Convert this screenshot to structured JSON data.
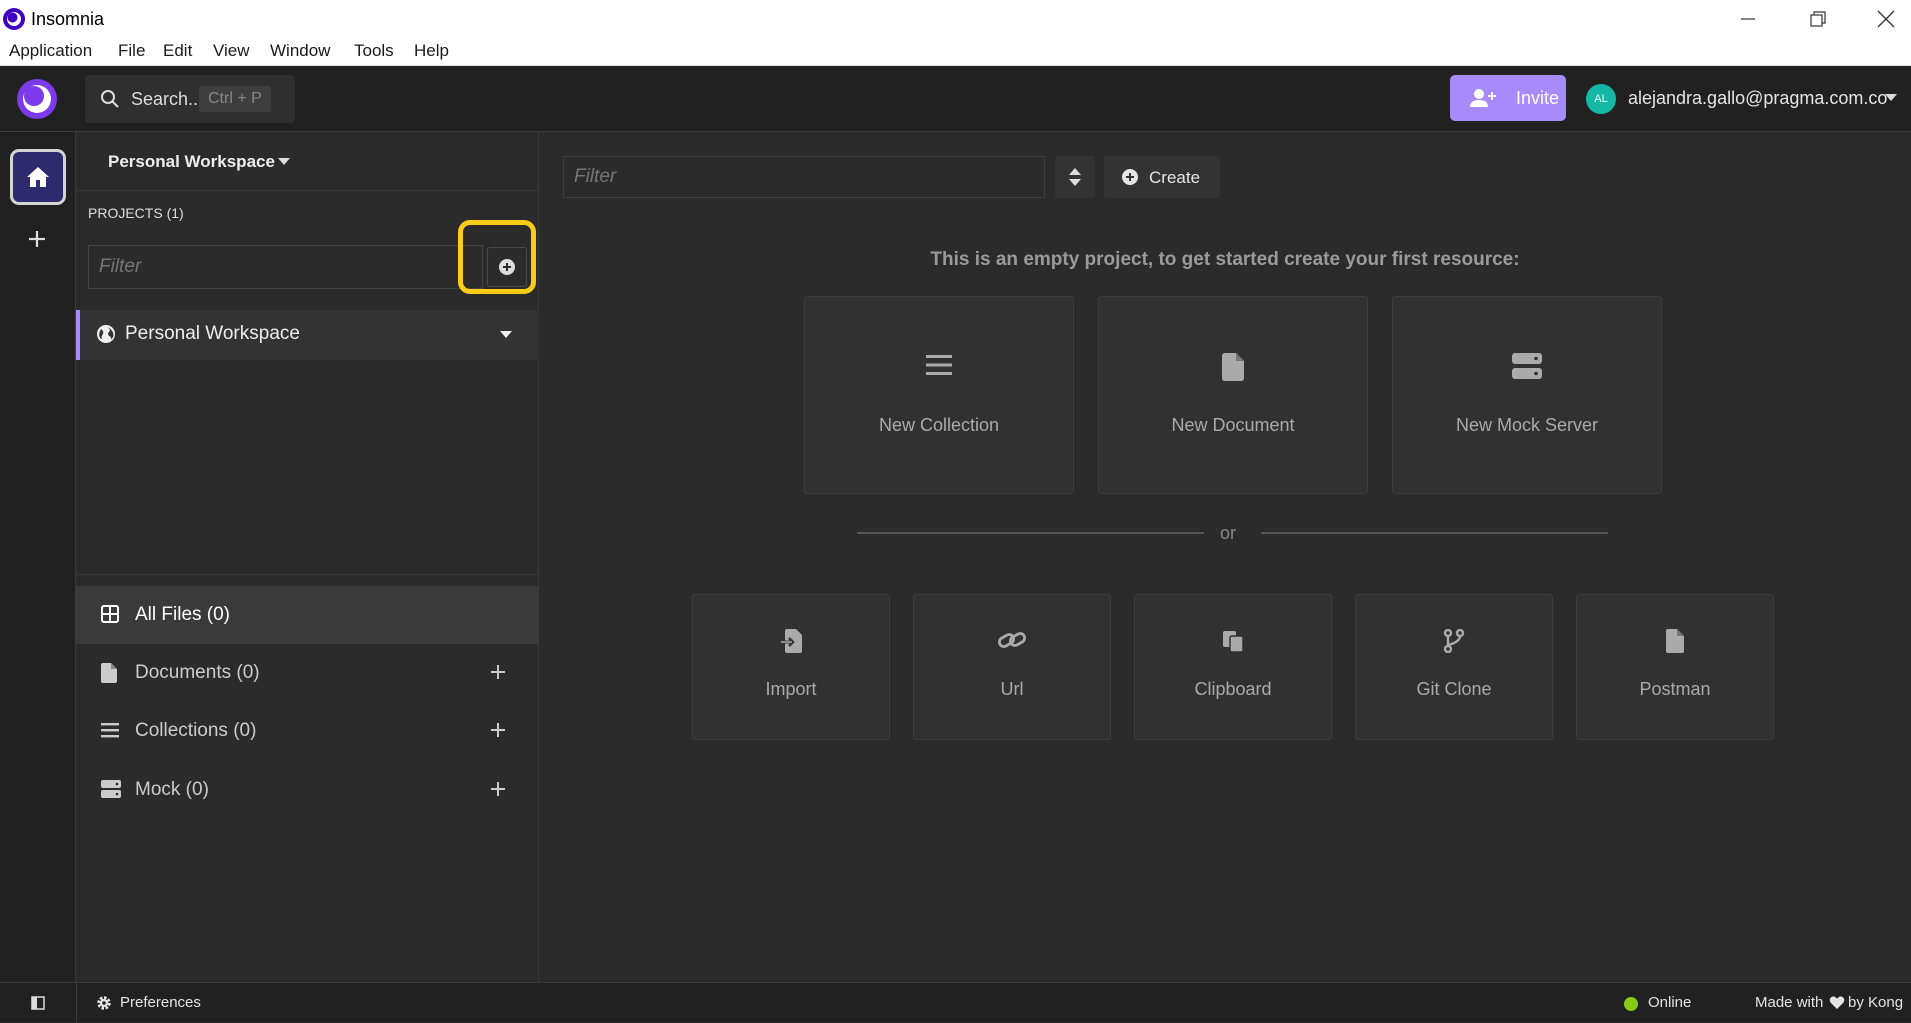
{
  "window": {
    "title": "Insomnia",
    "menu": [
      "Application",
      "File",
      "Edit",
      "View",
      "Window",
      "Tools",
      "Help"
    ]
  },
  "header": {
    "search_label": "Search..",
    "search_shortcut": "Ctrl + P",
    "invite_label": "Invite",
    "avatar_initials": "AL",
    "user_email": "alejandra.gallo@pragma.com.co"
  },
  "projects_panel": {
    "workspace_title": "Personal Workspace",
    "projects_label": "PROJECTS (1)",
    "filter_placeholder": "Filter",
    "projects": [
      {
        "name": "Personal Workspace",
        "icon": "globe-icon"
      }
    ],
    "file_types": [
      {
        "label": "All Files (0)",
        "icon": "grid-icon",
        "active": true
      },
      {
        "label": "Documents (0)",
        "icon": "document-icon"
      },
      {
        "label": "Collections (0)",
        "icon": "list-icon"
      },
      {
        "label": "Mock (0)",
        "icon": "server-icon"
      }
    ]
  },
  "main": {
    "filter_placeholder": "Filter",
    "create_label": "Create",
    "empty_message": "This is an empty project, to get started create your first resource:",
    "new_cards": [
      {
        "label": "New Collection",
        "icon": "list-icon"
      },
      {
        "label": "New Document",
        "icon": "document-icon"
      },
      {
        "label": "New Mock Server",
        "icon": "server-icon"
      }
    ],
    "or_text": "or",
    "import_cards": [
      {
        "label": "Import",
        "icon": "import-icon"
      },
      {
        "label": "Url",
        "icon": "link-icon"
      },
      {
        "label": "Clipboard",
        "icon": "clipboard-icon"
      },
      {
        "label": "Git Clone",
        "icon": "git-branch-icon"
      },
      {
        "label": "Postman",
        "icon": "document-icon"
      }
    ]
  },
  "statusbar": {
    "preferences_label": "Preferences",
    "status": "Online",
    "made_with": "Made with",
    "by_kong": "by Kong"
  },
  "colors": {
    "accent": "#a78bfa",
    "highlight": "#facc15",
    "online": "#84cc16",
    "avatar": "#14b8a6"
  }
}
